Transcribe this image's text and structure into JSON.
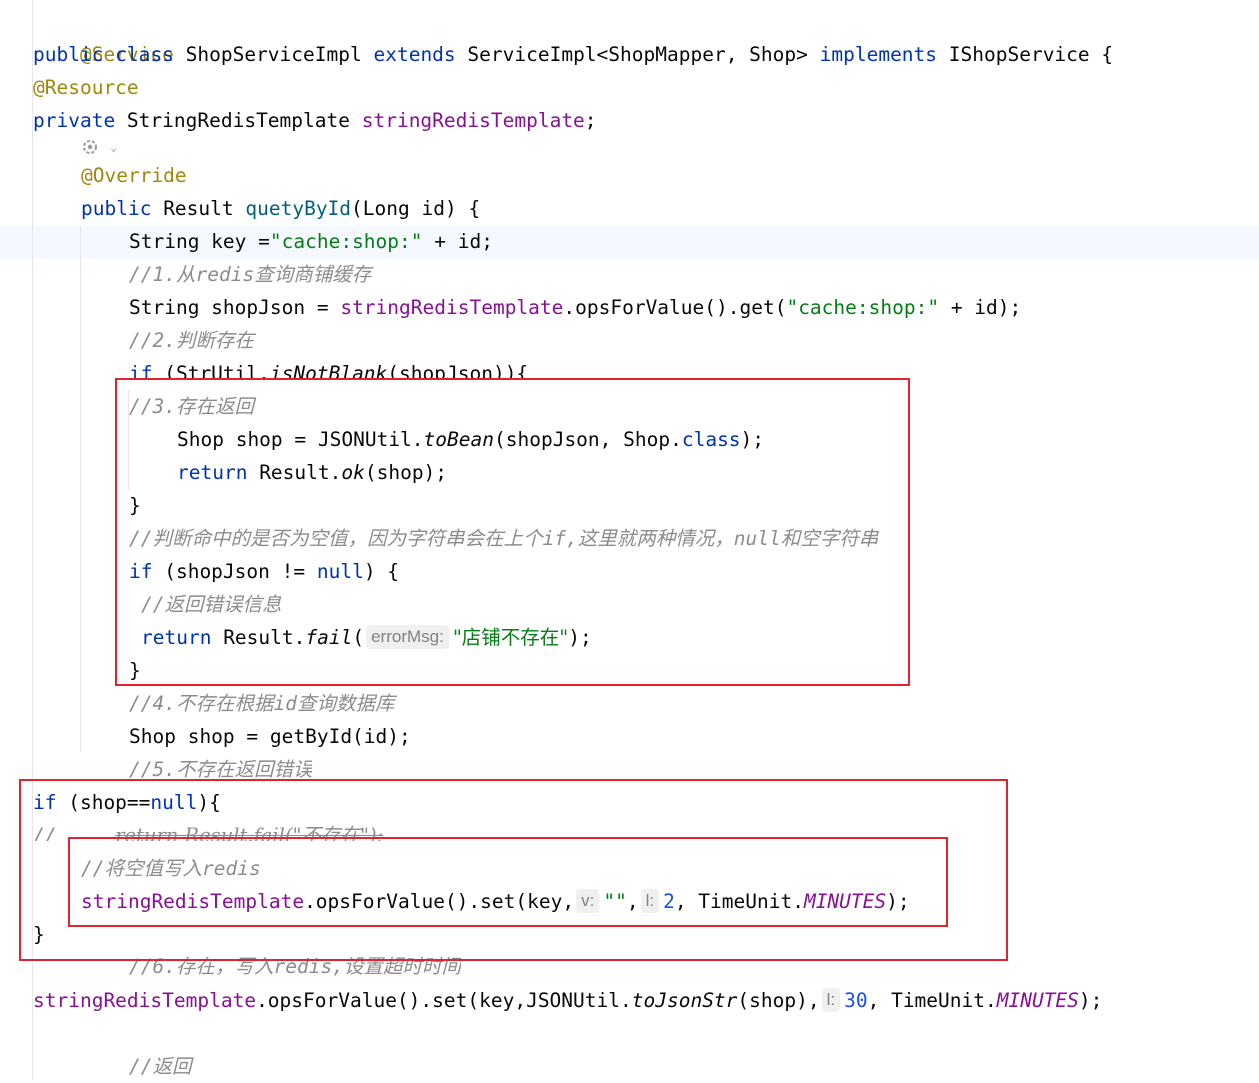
{
  "editor": {
    "lines": {
      "l01_ann": "@Service",
      "l02_kw1": "public class",
      "l02_t1": " ShopServiceImpl ",
      "l02_kw2": "extends",
      "l02_t2": " ServiceImpl<ShopMapper, Shop> ",
      "l02_kw3": "implements",
      "l02_t3": " IShopService {",
      "l03_ann": "@Resource",
      "l04_kw": "private",
      "l04_t": " StringRedisTemplate ",
      "l04_fld": "stringRedisTemplate",
      "l04_end": ";",
      "l06_ann": "@Override",
      "l07_kw": "public",
      "l07_t": " Result ",
      "l07_fn": "quetyById",
      "l07_end": "(Long id) {",
      "l08_t": "String key =",
      "l08_str": "\"cache:shop:\"",
      "l08_end": " + id;",
      "l09_cmt": "//1.",
      "l09_cmt2": "从",
      "l09_cmt3": "redis",
      "l09_cmt4": "查询商铺缓存",
      "l10_t": "String shopJson = ",
      "l10_fld": "stringRedisTemplate",
      "l10_t2": ".opsForValue().get(",
      "l10_str": "\"cache:shop:\"",
      "l10_end": " + id);",
      "l11_cmt": "//2.",
      "l11_cmt2": "判断存在",
      "l12_kw": "if",
      "l12_t": " (StrUtil.",
      "l12_ita": "isNotBlank",
      "l12_end": "(shopJson)){",
      "l13_cmt": "//3.",
      "l13_cmt2": "存在返回",
      "l14_t": "Shop shop = JSONUtil.",
      "l14_ita": "toBean",
      "l14_t2": "(shopJson, Shop.",
      "l14_kw": "class",
      "l14_end": ");",
      "l15_kw": "return",
      "l15_t": " Result.",
      "l15_ita": "ok",
      "l15_end": "(shop);",
      "l16_t": "}",
      "l17_cmt": "//",
      "l17_cmt2": "判断命中的是否为空值，因为字符串会在上个",
      "l17_cmt3": "if,",
      "l17_cmt4": "这里就两种情况，",
      "l17_cmt5": "null",
      "l17_cmt6": "和空字符串",
      "l18_kw": "if",
      "l18_t": " (shopJson != ",
      "l18_kw2": "null",
      "l18_end": ") {",
      "l19_cmt": "//",
      "l19_cmt2": "返回错误信息",
      "l20_kw": "return",
      "l20_t": " Result.",
      "l20_ita": "fail",
      "l20_t2": "(",
      "l20_hint": "errorMsg:",
      "l20_str": "\"店铺不存在\"",
      "l20_end": ");",
      "l21_t": "}",
      "l22_cmt": "//4.",
      "l22_cmt2": "不存在根据",
      "l22_cmt3": "id",
      "l22_cmt4": "查询数据库",
      "l23_t": "Shop shop = getById(id);",
      "l24_cmt": "//5.",
      "l24_cmt2": "不存在返回错误",
      "l25_kw": "if",
      "l25_t": " (shop==",
      "l25_kw2": "null",
      "l25_end": "){",
      "l26_cmt": "//",
      "l26_strike": "return Result.fail(\"不存在\");",
      "l27_cmt": "//",
      "l27_cmt2": "将空值写入",
      "l27_cmt3": "redis",
      "l28_fld": "stringRedisTemplate",
      "l28_t": ".opsForValue().set(key,",
      "l28_hint1": "v:",
      "l28_str": "\"\"",
      "l28_t2": ",",
      "l28_hint2": "l:",
      "l28_num": "2",
      "l28_t3": ", TimeUnit.",
      "l28_cst": "MINUTES",
      "l28_end": ");",
      "l29_t": "}",
      "l30_cmt": "//6.",
      "l30_cmt2": "存在，写入",
      "l30_cmt3": "redis,",
      "l30_cmt4": "设置超时时间",
      "l31_fld": "stringRedisTemplate",
      "l31_t": ".opsForValue().set(key,JSONUtil.",
      "l31_ita": "toJsonStr",
      "l31_t2": "(shop),",
      "l31_hint": "l:",
      "l31_num": "30",
      "l31_t3": ", TimeUnit.",
      "l31_cst": "MINUTES",
      "l31_end": ");",
      "l33_cmt": "//",
      "l33_cmt2": "返回"
    }
  },
  "colors": {
    "annotation": "#9e880d",
    "keyword": "#0033b3",
    "field": "#871094",
    "method": "#00627a",
    "string": "#067d17",
    "number": "#1750eb",
    "comment": "#8c8c8c",
    "highlight_box": "#e0242d"
  },
  "icons": {
    "gutter_gear": "gear-icon"
  }
}
